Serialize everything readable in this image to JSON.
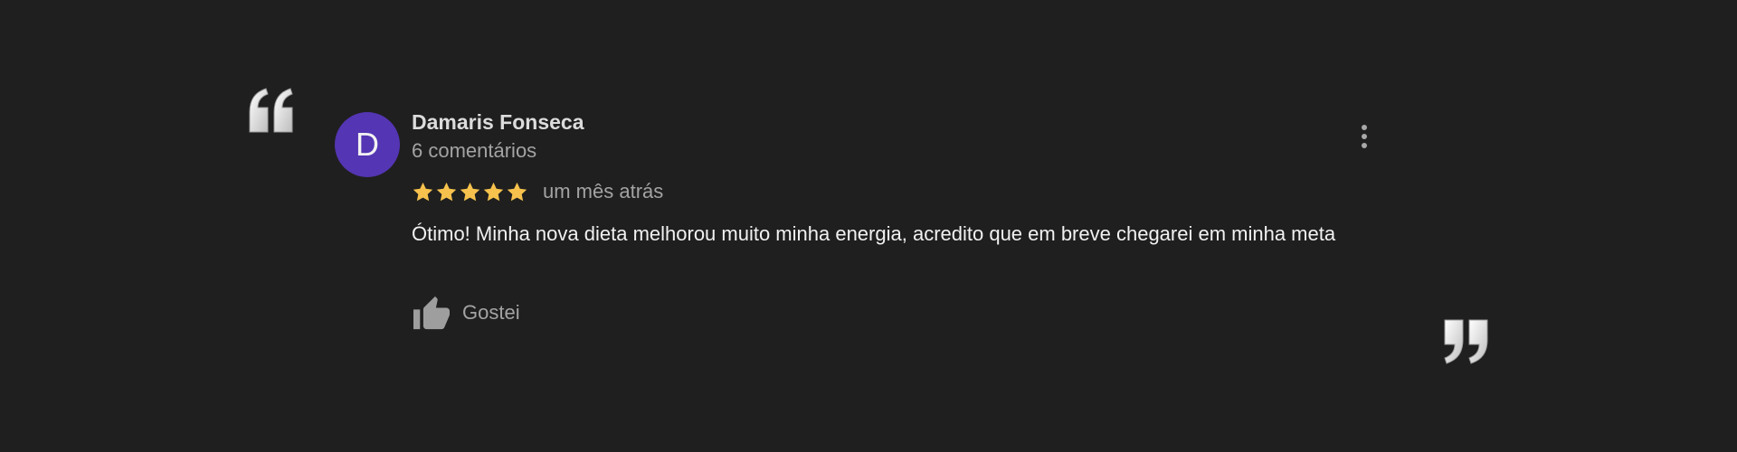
{
  "review": {
    "avatar_initial": "D",
    "author_name": "Damaris Fonseca",
    "author_meta": "6 comentários",
    "rating": 5,
    "rating_max": 5,
    "time_ago": "um mês atrás",
    "text": "Ótimo! Minha nova dieta melhorou muito minha energia, acredito que em breve chegarei em minha meta",
    "like_label": "Gostei"
  },
  "icons": {
    "open_quote": "quote-open-icon",
    "close_quote": "quote-close-icon",
    "star": "star-icon",
    "like": "thumbs-up-icon",
    "more": "more-vertical-icon"
  },
  "colors": {
    "background": "#1f1f1f",
    "avatar": "#5435b3",
    "star": "#f6c24d",
    "text_primary": "#f1f1f1",
    "text_secondary": "#a3a3a3"
  }
}
